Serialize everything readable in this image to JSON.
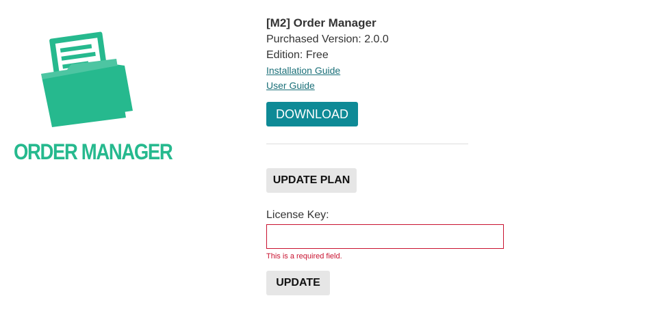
{
  "logo": {
    "text": "ORDER MANAGER",
    "icon": "folder-document-icon",
    "color": "#26b98e"
  },
  "product": {
    "title": "[M2] Order Manager",
    "purchased_version": "Purchased Version: 2.0.0",
    "edition": "Edition: Free",
    "installation_guide_link": "Installation Guide",
    "user_guide_link": "User Guide"
  },
  "actions": {
    "download_label": "DOWNLOAD",
    "update_plan_label": "UPDATE PLAN",
    "update_label": "UPDATE"
  },
  "license": {
    "label": "License Key:",
    "value": "",
    "placeholder": "",
    "error": "This is a required field."
  },
  "colors": {
    "accent": "#0e8a96",
    "brand": "#26b98e",
    "error": "#c8102e",
    "link": "#1a6f78"
  }
}
